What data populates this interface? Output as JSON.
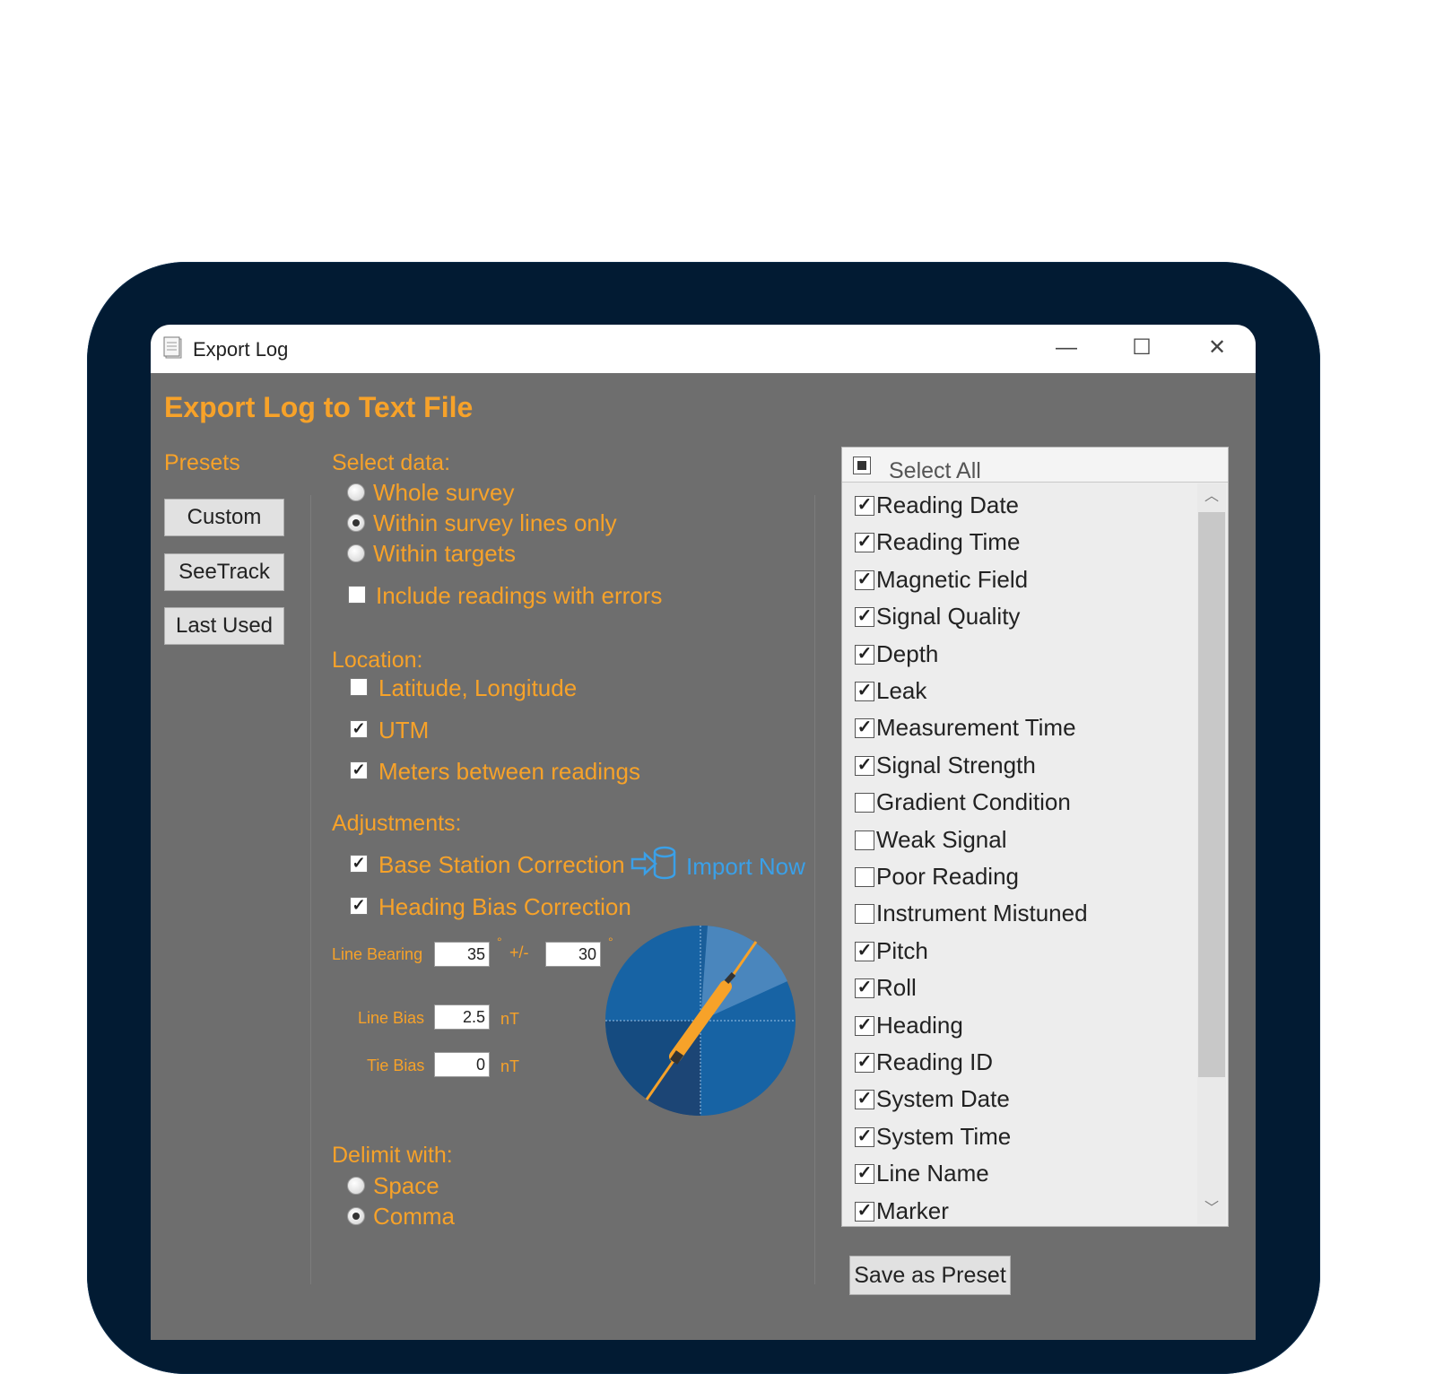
{
  "window": {
    "title": "Export Log",
    "controls": {
      "minimize": "—",
      "maximize": "☐",
      "close": "✕"
    }
  },
  "header": {
    "title": "Export Log to Text File"
  },
  "presets": {
    "label": "Presets",
    "buttons": [
      "Custom",
      "SeeTrack",
      "Last Used"
    ]
  },
  "select_data": {
    "label": "Select data:",
    "options": [
      {
        "label": "Whole survey",
        "selected": false
      },
      {
        "label": "Within survey lines only",
        "selected": true
      },
      {
        "label": "Within targets",
        "selected": false
      }
    ],
    "include_errors": {
      "label": "Include readings with errors",
      "checked": false
    }
  },
  "location": {
    "label": "Location:",
    "options": [
      {
        "label": "Latitude, Longitude",
        "checked": false
      },
      {
        "label": "UTM",
        "checked": true
      },
      {
        "label": "Meters between readings",
        "checked": true
      }
    ]
  },
  "adjustments": {
    "label": "Adjustments:",
    "base_station": {
      "label": "Base Station Correction",
      "checked": true
    },
    "import_now": "Import Now",
    "heading_bias": {
      "label": "Heading Bias Correction",
      "checked": true
    },
    "line_bearing": {
      "label": "Line Bearing",
      "value": "35",
      "degree": "°",
      "plusminus": "+/-",
      "tolerance": "30",
      "degree2": "°"
    },
    "line_bias": {
      "label": "Line Bias",
      "value": "2.5",
      "unit": "nT"
    },
    "tie_bias": {
      "label": "Tie Bias",
      "value": "0",
      "unit": "nT"
    }
  },
  "delimit": {
    "label": "Delimit with:",
    "options": [
      {
        "label": "Space",
        "selected": false
      },
      {
        "label": "Comma",
        "selected": true
      }
    ]
  },
  "fields": {
    "select_all": "Select All",
    "items": [
      {
        "label": "Reading Date",
        "checked": true
      },
      {
        "label": "Reading Time",
        "checked": true
      },
      {
        "label": "Magnetic Field",
        "checked": true
      },
      {
        "label": "Signal Quality",
        "checked": true
      },
      {
        "label": "Depth",
        "checked": true
      },
      {
        "label": "Leak",
        "checked": true
      },
      {
        "label": "Measurement Time",
        "checked": true
      },
      {
        "label": "Signal Strength",
        "checked": true
      },
      {
        "label": "Gradient Condition",
        "checked": false
      },
      {
        "label": "Weak Signal",
        "checked": false
      },
      {
        "label": "Poor Reading",
        "checked": false
      },
      {
        "label": "Instrument Mistuned",
        "checked": false
      },
      {
        "label": "Pitch",
        "checked": true
      },
      {
        "label": "Roll",
        "checked": true
      },
      {
        "label": "Heading",
        "checked": true
      },
      {
        "label": "Reading ID",
        "checked": true
      },
      {
        "label": "System Date",
        "checked": true
      },
      {
        "label": "System Time",
        "checked": true
      },
      {
        "label": "Line Name",
        "checked": true
      },
      {
        "label": "Marker",
        "checked": true
      }
    ]
  },
  "save_preset": "Save as Preset",
  "colors": {
    "accent": "#f7a229",
    "link": "#3aa0e8",
    "panel": "#6e6e6e",
    "frame": "#021b33"
  }
}
